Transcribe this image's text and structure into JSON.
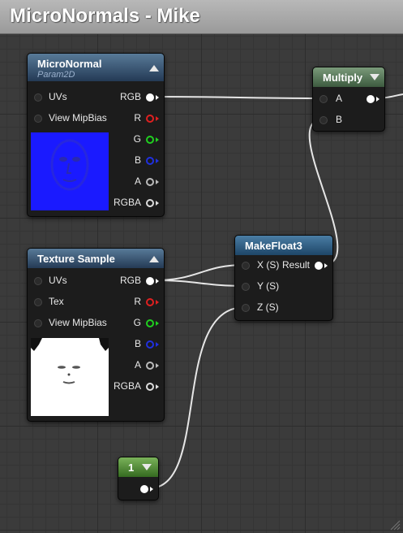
{
  "window": {
    "title": "MicroNormals - Mike"
  },
  "colors": {
    "wire": "#e6e6e6",
    "pin_r": "#e02020",
    "pin_g": "#20d020",
    "pin_b": "#2030e0",
    "preview_blue": "#1a1aff"
  },
  "nodes": {
    "micro_normal": {
      "title": "MicroNormal",
      "subtitle": "Param2D",
      "inputs": [
        "UVs",
        "View MipBias"
      ],
      "outputs": [
        "RGB",
        "R",
        "G",
        "B",
        "A",
        "RGBA"
      ]
    },
    "texture_sample": {
      "title": "Texture Sample",
      "inputs": [
        "UVs",
        "Tex",
        "View MipBias"
      ],
      "outputs": [
        "RGB",
        "R",
        "G",
        "B",
        "A",
        "RGBA"
      ]
    },
    "multiply": {
      "title": "Multiply",
      "inputs": [
        "A",
        "B"
      ]
    },
    "make_float3": {
      "title": "MakeFloat3",
      "inputs": [
        "X (S)",
        "Y (S)",
        "Z (S)"
      ],
      "output": "Result"
    },
    "constant": {
      "title": "1"
    }
  },
  "icons": {
    "collapse": "triangle-up-icon",
    "expand": "triangle-down-icon",
    "resize": "resize-grip-icon"
  }
}
